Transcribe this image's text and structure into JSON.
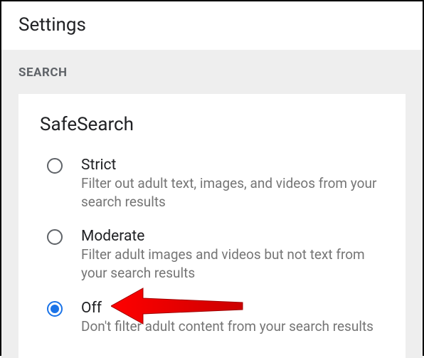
{
  "header": {
    "title": "Settings"
  },
  "section": {
    "label": "SEARCH"
  },
  "card": {
    "title": "SafeSearch",
    "options": [
      {
        "label": "Strict",
        "description": "Filter out adult text, images, and videos from your search results",
        "selected": false
      },
      {
        "label": "Moderate",
        "description": "Filter adult images and videos but not text from your search results",
        "selected": false
      },
      {
        "label": "Off",
        "description": "Don't filter adult content from your search results",
        "selected": true
      }
    ]
  }
}
